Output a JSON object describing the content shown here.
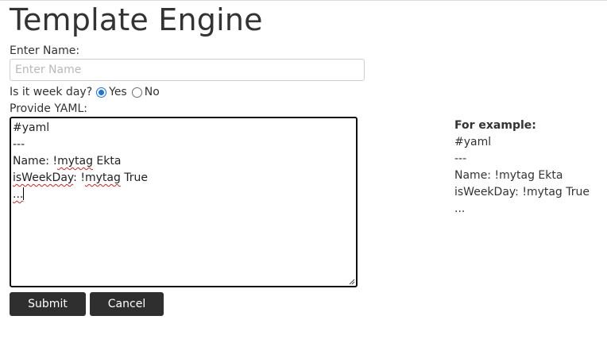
{
  "page": {
    "title": "Template Engine"
  },
  "name_field": {
    "label": "Enter Name:",
    "placeholder": "Enter Name",
    "value": ""
  },
  "weekday": {
    "question": "Is it week day?",
    "options": [
      {
        "label": "Yes",
        "selected": true
      },
      {
        "label": "No",
        "selected": false
      }
    ]
  },
  "yaml": {
    "label": "Provide YAML:",
    "lines": [
      {
        "pre": "#yaml",
        "squiggle": "",
        "post": ""
      },
      {
        "pre": "---",
        "squiggle": "",
        "post": ""
      },
      {
        "pre": "Name: !",
        "squiggle": "mytag",
        "post": " Ekta"
      },
      {
        "pre": "",
        "squiggle": "isWeekDay",
        "post": ": !"
      },
      {
        "pre": "",
        "squiggle": "...",
        "post": ""
      }
    ],
    "line4_tail_squiggle": "mytag",
    "line4_tail_post": " True"
  },
  "buttons": {
    "submit": "Submit",
    "cancel": "Cancel"
  },
  "example": {
    "heading": "For example:",
    "lines": [
      "#yaml",
      "---",
      "Name: !mytag Ekta",
      "isWeekDay: !mytag True",
      "..."
    ]
  },
  "colors": {
    "button_bg": "#2f2f2f",
    "radio_accent": "#1a73e8",
    "spellcheck": "#d62222"
  }
}
